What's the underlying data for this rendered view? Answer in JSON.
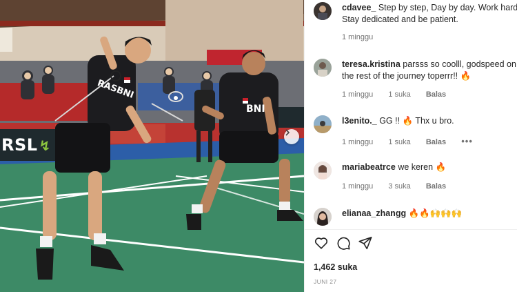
{
  "post": {
    "banner_text": "RSL",
    "shirt_left": "RASBNI",
    "shirt_right": "BNI"
  },
  "comments": [
    {
      "username": "cdavee_",
      "text": "Step by step, Day by day. Work hard, Stay dedicated and be patient.",
      "time": "1 minggu",
      "likes": "",
      "reply": ""
    },
    {
      "username": "teresa.kristina",
      "text": "parsss so coolll, godspeed on the rest of the journey toperrr!! 🔥",
      "time": "1 minggu",
      "likes": "1 suka",
      "reply": "Balas"
    },
    {
      "username": "l3enito._",
      "text": "GG !! 🔥 Thx u bro.",
      "time": "1 minggu",
      "likes": "1 suka",
      "reply": "Balas",
      "more": "•••"
    },
    {
      "username": "mariabeatrce",
      "text": "we keren 🔥",
      "time": "1 minggu",
      "likes": "3 suka",
      "reply": "Balas"
    },
    {
      "username": "elianaa_zhangg",
      "text": "🔥🔥🙌🙌🙌",
      "time": "",
      "likes": "",
      "reply": ""
    }
  ],
  "likes_count": "1,462 suka",
  "date": "JUNI 27",
  "icons": [
    "heart-icon",
    "comment-icon",
    "share-icon",
    "chevron-right-icon"
  ],
  "colors": {
    "court": "#3d8a66",
    "accent_red": "#c8202a",
    "text": "#262626",
    "muted": "#737373"
  }
}
